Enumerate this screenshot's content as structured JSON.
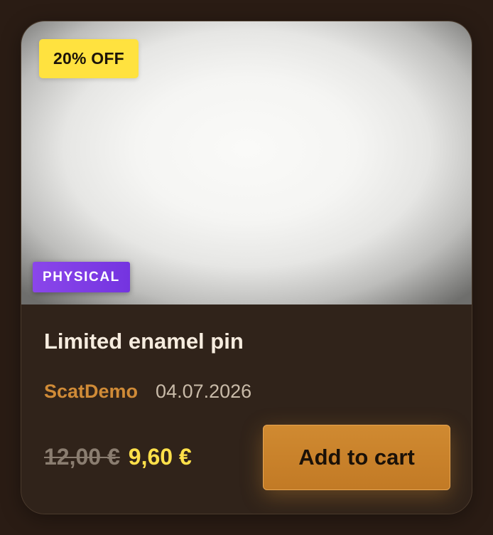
{
  "product": {
    "discount_badge": "20% OFF",
    "type_badge": "PHYSICAL",
    "title": "Limited enamel pin",
    "author": "ScatDemo",
    "date": "04.07.2026",
    "old_price": "12,00 €",
    "new_price": "9,60 €",
    "add_to_cart_label": "Add to cart"
  },
  "colors": {
    "page_background": "#2a1c14",
    "card_background": "#30231a",
    "discount_badge": "#ffe23f",
    "type_badge": "#7f3fe6",
    "author": "#d08b37",
    "new_price": "#ffe04a",
    "button": "#c98230"
  }
}
